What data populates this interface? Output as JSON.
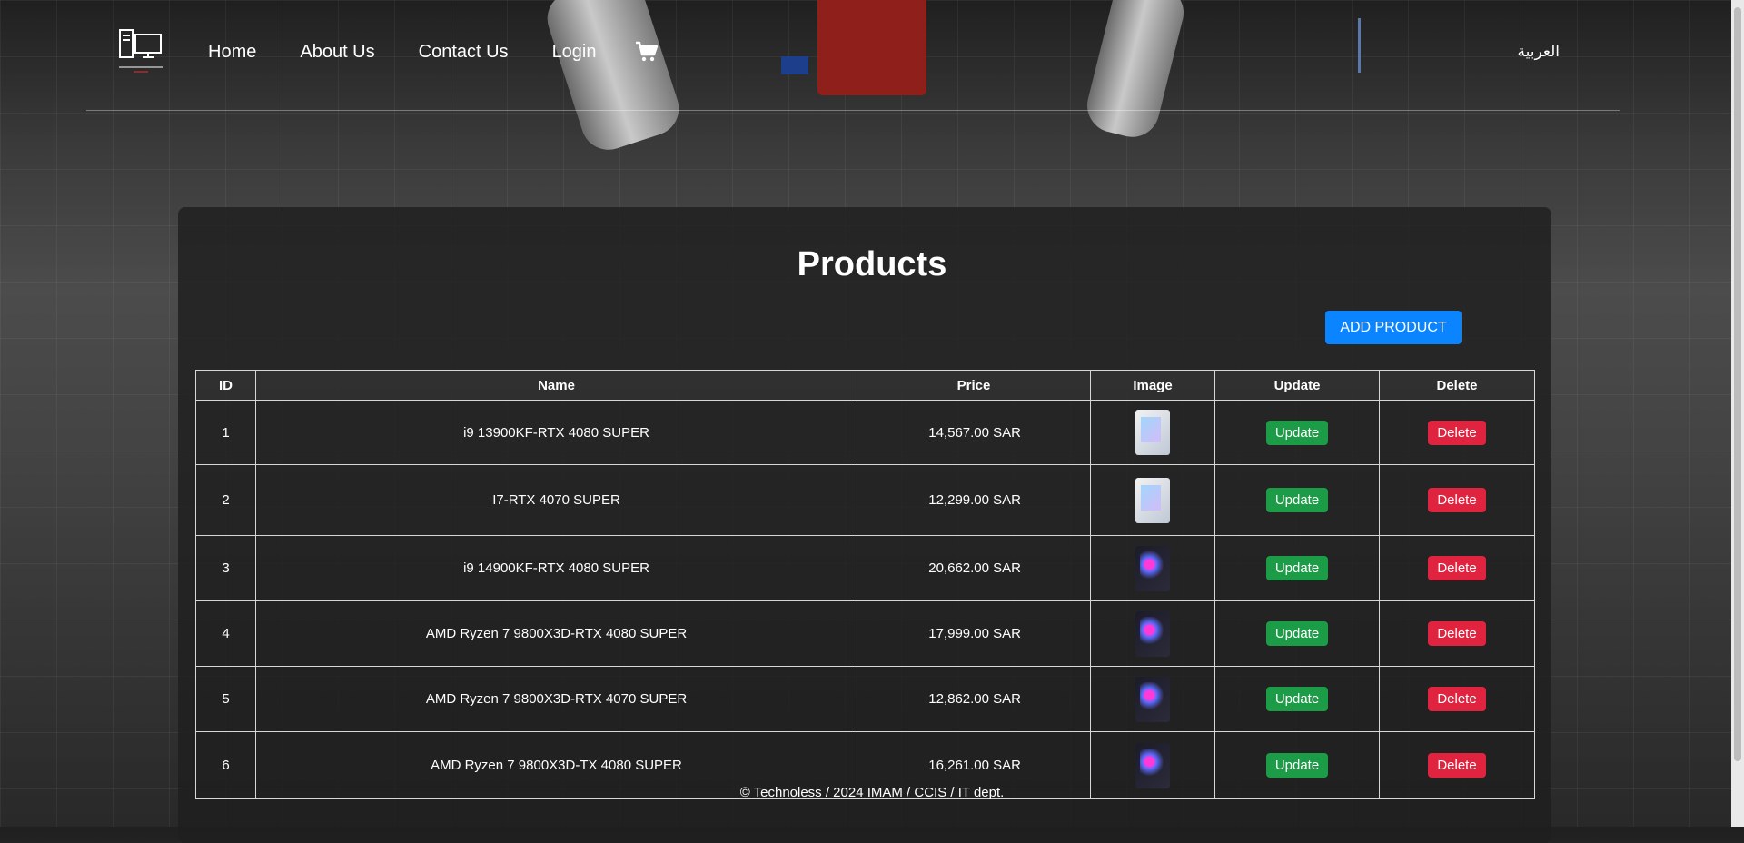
{
  "header": {
    "nav": [
      "Home",
      "About Us",
      "Contact Us",
      "Login"
    ],
    "language": "العربية"
  },
  "page": {
    "title": "Products",
    "add_button": "ADD PRODUCT"
  },
  "table": {
    "headers": [
      "ID",
      "Name",
      "Price",
      "Image",
      "Update",
      "Delete"
    ],
    "rows": [
      {
        "id": "1",
        "name": "i9 13900KF-RTX 4080 SUPER",
        "price": "14,567.00 SAR",
        "image": "white-case",
        "update": "Update",
        "delete": "Delete"
      },
      {
        "id": "2",
        "name": "I7-RTX 4070 SUPER",
        "price": "12,299.00 SAR",
        "image": "white-case",
        "update": "Update",
        "delete": "Delete"
      },
      {
        "id": "3",
        "name": "i9 14900KF-RTX 4080 SUPER",
        "price": "20,662.00 SAR",
        "image": "dark-rgb-case",
        "update": "Update",
        "delete": "Delete"
      },
      {
        "id": "4",
        "name": "AMD Ryzen 7 9800X3D-RTX 4080 SUPER",
        "price": "17,999.00 SAR",
        "image": "dark-rgb-case",
        "update": "Update",
        "delete": "Delete"
      },
      {
        "id": "5",
        "name": "AMD Ryzen 7 9800X3D-RTX 4070 SUPER",
        "price": "12,862.00 SAR",
        "image": "dark-rgb-case",
        "update": "Update",
        "delete": "Delete"
      },
      {
        "id": "6",
        "name": "AMD Ryzen 7 9800X3D-TX 4080 SUPER",
        "price": "16,261.00 SAR",
        "image": "dark-rgb-case",
        "update": "Update",
        "delete": "Delete"
      }
    ]
  },
  "footer": {
    "text": "© Technoless / 2024 IMAM / CCIS / IT dept."
  },
  "colors": {
    "add_button": "#0a84ff",
    "update_button": "#1c9c46",
    "delete_button": "#e0243f"
  }
}
